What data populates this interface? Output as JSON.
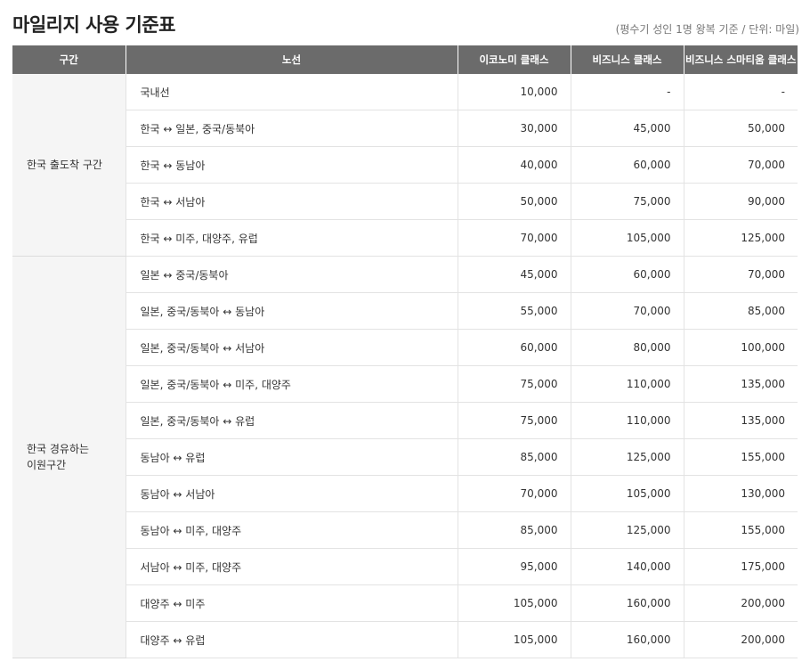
{
  "page": {
    "title": "마일리지 사용 기준표",
    "note": "(평수기 성인 1명 왕복 기준 / 단위: 마일)"
  },
  "table": {
    "headers": [
      "구간",
      "노선",
      "이코노미 클래스",
      "비즈니스 클래스",
      "비즈니스 스마티움 클래스"
    ],
    "sections": [
      {
        "label": "한국 출도착 구간",
        "rows": [
          {
            "route": "국내선",
            "economy": "10,000",
            "business": "-",
            "smartium": "-"
          },
          {
            "route": "한국 ↔ 일본, 중국/동북아",
            "economy": "30,000",
            "business": "45,000",
            "smartium": "50,000"
          },
          {
            "route": "한국 ↔ 동남아",
            "economy": "40,000",
            "business": "60,000",
            "smartium": "70,000"
          },
          {
            "route": "한국 ↔ 서남아",
            "economy": "50,000",
            "business": "75,000",
            "smartium": "90,000"
          },
          {
            "route": "한국 ↔ 미주, 대양주, 유럽",
            "economy": "70,000",
            "business": "105,000",
            "smartium": "125,000"
          }
        ]
      },
      {
        "label": "한국 경유하는\n이원구간",
        "rows": [
          {
            "route": "일본 ↔ 중국/동북아",
            "economy": "45,000",
            "business": "60,000",
            "smartium": "70,000"
          },
          {
            "route": "일본, 중국/동북아 ↔ 동남아",
            "economy": "55,000",
            "business": "70,000",
            "smartium": "85,000"
          },
          {
            "route": "일본, 중국/동북아 ↔ 서남아",
            "economy": "60,000",
            "business": "80,000",
            "smartium": "100,000"
          },
          {
            "route": "일본, 중국/동북아 ↔ 미주, 대양주",
            "economy": "75,000",
            "business": "110,000",
            "smartium": "135,000"
          },
          {
            "route": "일본, 중국/동북아 ↔ 유럽",
            "economy": "75,000",
            "business": "110,000",
            "smartium": "135,000"
          },
          {
            "route": "동남아 ↔ 유럽",
            "economy": "85,000",
            "business": "125,000",
            "smartium": "155,000"
          },
          {
            "route": "동남아 ↔ 서남아",
            "economy": "70,000",
            "business": "105,000",
            "smartium": "130,000"
          },
          {
            "route": "동남아 ↔ 미주, 대양주",
            "economy": "85,000",
            "business": "125,000",
            "smartium": "155,000"
          },
          {
            "route": "서남아 ↔ 미주, 대양주",
            "economy": "95,000",
            "business": "140,000",
            "smartium": "175,000"
          },
          {
            "route": "대양주 ↔ 미주",
            "economy": "105,000",
            "business": "160,000",
            "smartium": "200,000"
          },
          {
            "route": "대양주 ↔ 유럽",
            "economy": "105,000",
            "business": "160,000",
            "smartium": "200,000"
          }
        ]
      }
    ]
  },
  "colors": {
    "header_bg": "#6b6b6b",
    "section_bg": "#f5f5f5",
    "border": "#e3e3e3",
    "text": "#333333"
  }
}
